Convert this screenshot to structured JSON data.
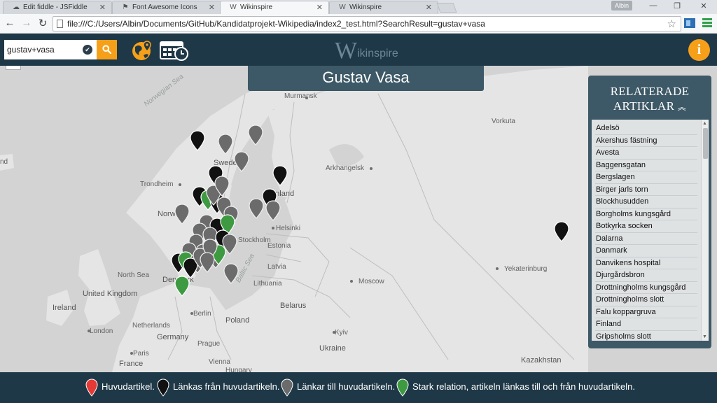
{
  "browser": {
    "tabs": [
      {
        "label": "Edit fiddle - JSFiddle",
        "icon": "cloud-icon"
      },
      {
        "label": "Font Awesome Icons",
        "icon": "flag-icon"
      },
      {
        "label": "Wikinspire",
        "icon": "wikipedia-icon"
      },
      {
        "label": "Wikinspire",
        "icon": "wikipedia-icon"
      }
    ],
    "user": "Albin",
    "url": "file:///C:/Users/Albin/Documents/GitHub/Kandidatprojekt-Wikipedia/index2_test.html?SearchResult=gustav+vasa"
  },
  "header": {
    "search_value": "gustav+vasa",
    "logo_initial": "W",
    "logo_rest": "ikinspire",
    "info_label": "i",
    "accent_color": "#f6a01a",
    "bar_color": "#1f3847"
  },
  "main": {
    "article_title": "Gustav Vasa"
  },
  "related": {
    "heading_line1": "RELATERADE",
    "heading_line2": "ARTIKLAR",
    "items": [
      "Adelsö",
      "Akershus fästning",
      "Avesta",
      "Baggensgatan",
      "Bergslagen",
      "Birger jarls torn",
      "Blockhusudden",
      "Borgholms kungsgård",
      "Botkyrka socken",
      "Dalarna",
      "Danmark",
      "Danvikens hospital",
      "Djurgårdsbron",
      "Drottningholms kungsgård",
      "Drottningholms slott",
      "Falu koppargruva",
      "Finland",
      "Gripsholms slott"
    ]
  },
  "map": {
    "places": [
      "Norwegian Sea",
      "Murmansk",
      "Vorkuta",
      "Sweden",
      "Arkhangelsk",
      "Trondheim",
      "Finland",
      "Norway",
      "Helsinki",
      "Stockholm",
      "Estonia",
      "Latvia",
      "Yekaterinburg",
      "North Sea",
      "Denmark",
      "Lithuania",
      "Moscow",
      "United Kingdom",
      "Ireland",
      "Baltic Sea",
      "Belarus",
      "Netherlands",
      "Berlin",
      "Poland",
      "London",
      "Germany",
      "Kyiv",
      "Ukraine",
      "Paris",
      "France",
      "Hungary",
      "Kazakhstan",
      "Prague",
      "Vienna",
      "nd"
    ]
  },
  "legend": [
    {
      "color": "#e53935",
      "label": "Huvudartikel."
    },
    {
      "color": "#111111",
      "label": "Länkas från huvudartikeln."
    },
    {
      "color": "#6b6b6b",
      "label": "Länkar till huvudartikeln."
    },
    {
      "color": "#3e9a41",
      "label": "Stark relation, artikeln länkas till och från huvudartikeln."
    }
  ]
}
